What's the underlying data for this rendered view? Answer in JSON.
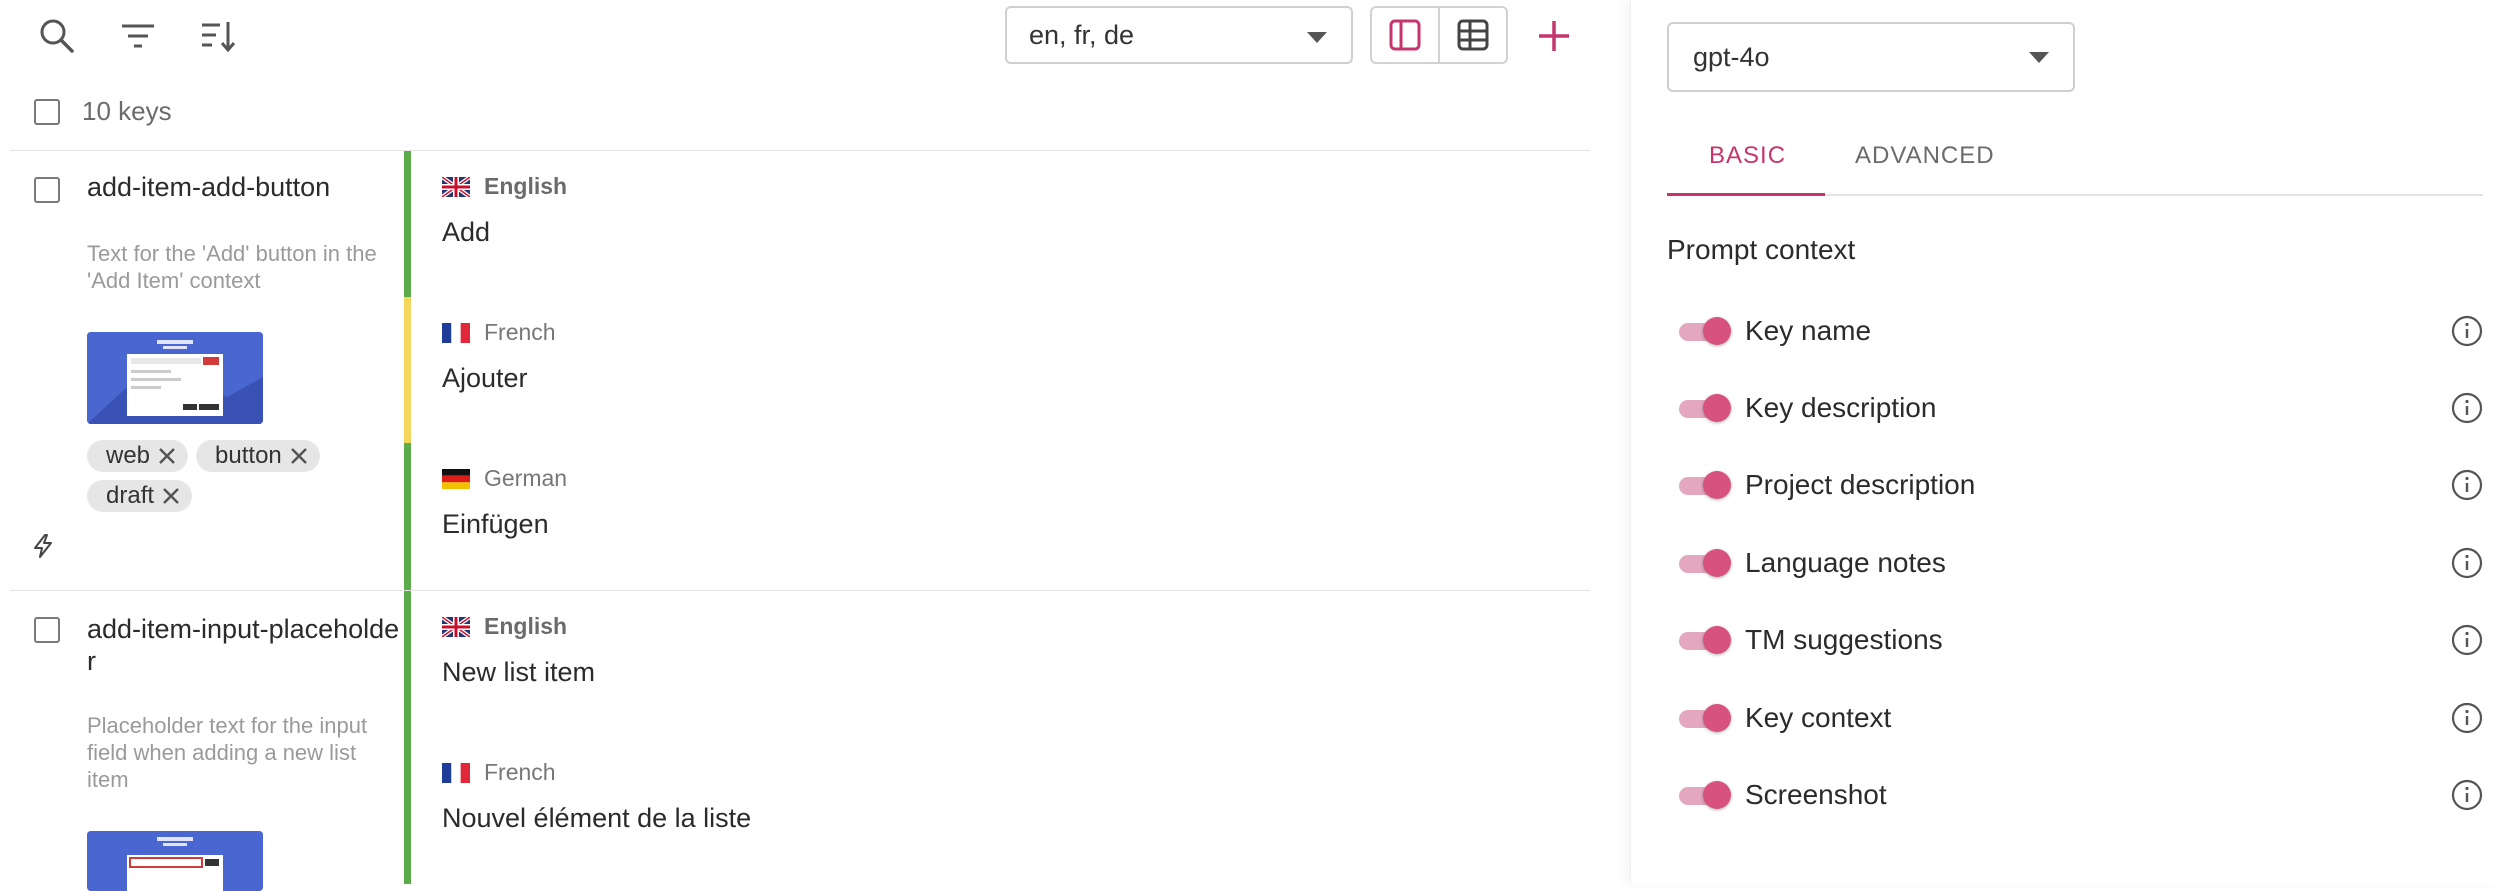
{
  "toolbar": {
    "languages_value": "en, fr, de",
    "add_label": "+"
  },
  "list_header": {
    "key_count": "10 keys"
  },
  "keys": [
    {
      "name": "add-item-add-button",
      "description": "Text for the 'Add' button in the 'Add Item' context",
      "tags": [
        "web",
        "button",
        "draft"
      ],
      "translations": [
        {
          "language": "English",
          "text": "Add",
          "status_color": "#5bab4a"
        },
        {
          "language": "French",
          "text": "Ajouter",
          "status_color": "#f2d75c"
        },
        {
          "language": "German",
          "text": "Einfügen",
          "status_color": "#5bab4a"
        }
      ]
    },
    {
      "name": "add-item-input-placeholder",
      "description": "Placeholder text for the input field when adding a new list item",
      "translations": [
        {
          "language": "English",
          "text": "New list item",
          "status_color": "#5bab4a"
        },
        {
          "language": "French",
          "text": "Nouvel élément de la liste",
          "status_color": "#5bab4a"
        }
      ]
    }
  ],
  "panel": {
    "model_value": "gpt-4o",
    "tabs": [
      "BASIC",
      "ADVANCED"
    ],
    "active_tab": "BASIC",
    "prompt_context_title": "Prompt context",
    "options": [
      {
        "label": "Key name",
        "enabled": true
      },
      {
        "label": "Key description",
        "enabled": true
      },
      {
        "label": "Project description",
        "enabled": true
      },
      {
        "label": "Language notes",
        "enabled": true
      },
      {
        "label": "TM suggestions",
        "enabled": true
      },
      {
        "label": "Key context",
        "enabled": true
      },
      {
        "label": "Screenshot",
        "enabled": true
      }
    ]
  },
  "colors": {
    "accent": "#c6346d",
    "toggle_knob": "#d7527f",
    "toggle_track": "#e3a8c0",
    "state_translated": "#5bab4a",
    "state_draft": "#f2d75c"
  }
}
